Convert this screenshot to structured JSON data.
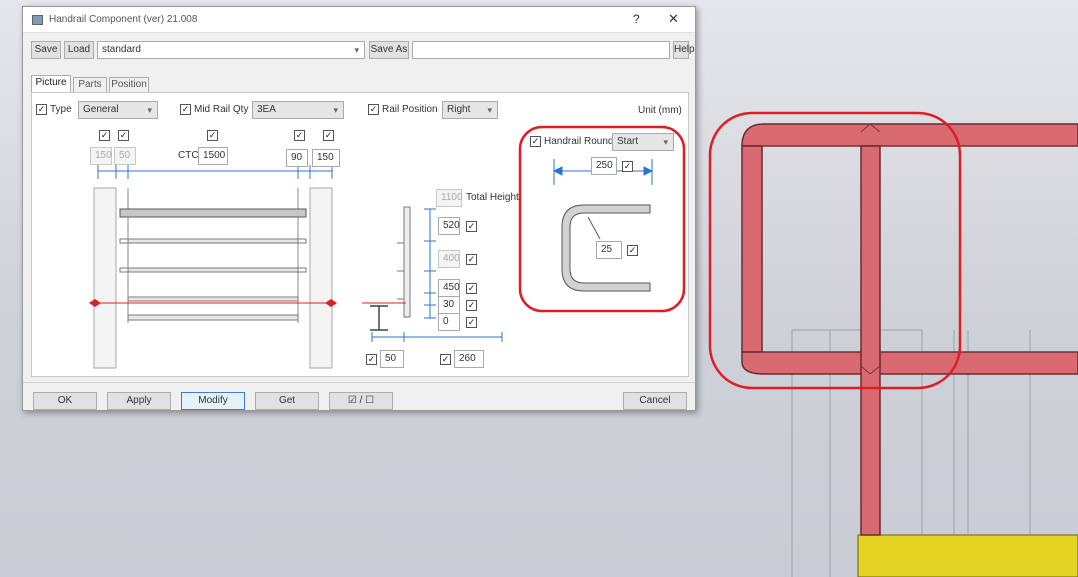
{
  "window": {
    "title": "Handrail Component (ver) 21.008",
    "help_label": "?",
    "close_label": "✕"
  },
  "toolbar": {
    "save_label": "Save",
    "load_label": "Load",
    "preset_value": "standard",
    "save_as_label": "Save As",
    "save_as_value": "",
    "help_label": "Help"
  },
  "tabs": [
    {
      "label": "Picture"
    },
    {
      "label": "Parts"
    },
    {
      "label": "Position"
    }
  ],
  "picture": {
    "type_label": "Type",
    "type_value": "General",
    "mid_rail_label": "Mid Rail Qty",
    "mid_rail_value": "3EA",
    "rail_position_label": "Rail Position",
    "rail_position_value": "Right",
    "unit_label": "Unit (mm)",
    "post_dims": {
      "left_a": "150",
      "left_b": "50",
      "ctc_label": "CTC",
      "ctc_value": "1500",
      "right_a": "90",
      "right_b": "150"
    },
    "height": {
      "total_value": "1100",
      "total_label": "Total Height",
      "top_value": "520",
      "mid_value": "400",
      "lower_value": "450",
      "base_value": "30",
      "bottom_value": "0",
      "offset_left_value": "50",
      "offset_right_value": "260"
    },
    "handrail_round": {
      "label": "Handrail Round",
      "mode_value": "Start",
      "length_value": "250",
      "radius_value": "25"
    }
  },
  "footer": {
    "ok_label": "OK",
    "apply_label": "Apply",
    "modify_label": "Modify",
    "get_label": "Get",
    "toggle_label": "☑ / ☐",
    "cancel_label": "Cancel"
  },
  "colors": {
    "rail_fill": "#d96a72",
    "rail_stroke": "#6a2a30",
    "highlight_red": "#e01c24",
    "base_yellow": "#e3d322",
    "dim_blue": "#2a74d6"
  }
}
